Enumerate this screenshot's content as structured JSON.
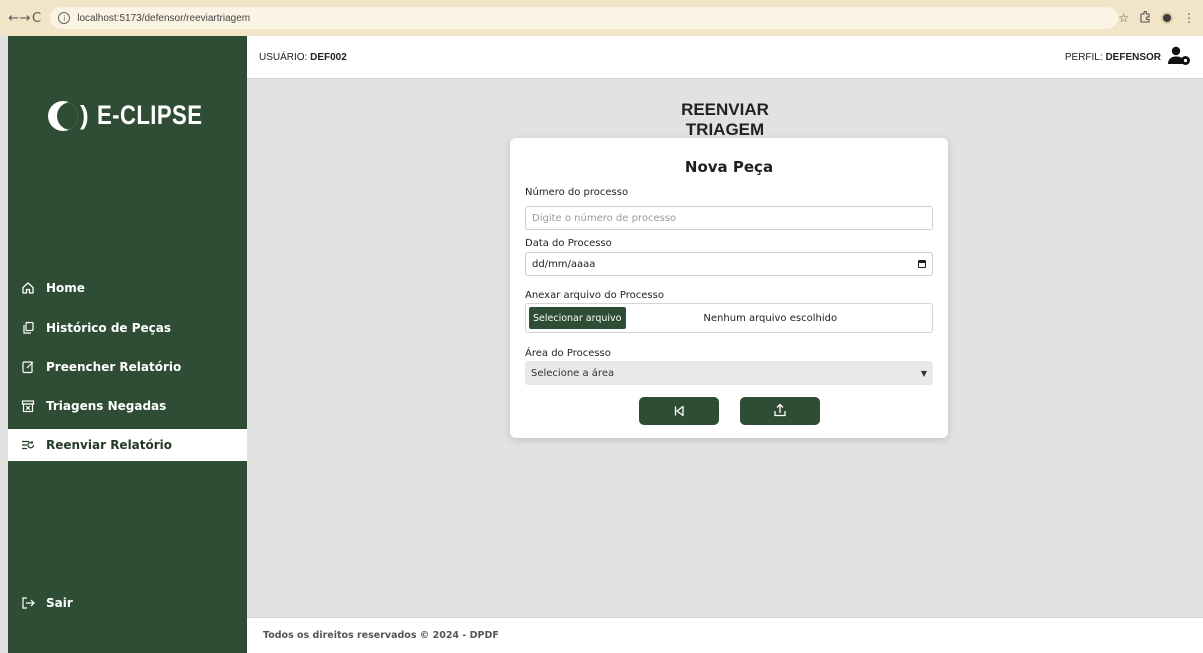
{
  "browser": {
    "url": "localhost:5173/defensor/reeviartriagem",
    "back_glyph": "←",
    "forward_glyph": "→",
    "reload_glyph": "C"
  },
  "sidebar": {
    "logo_text": "E-CLIPSE",
    "logo_paren": ")",
    "items": [
      {
        "label": "Home",
        "icon": "home-icon"
      },
      {
        "label": "Histórico de Peças",
        "icon": "history-icon"
      },
      {
        "label": "Preencher Relatório",
        "icon": "edit-report-icon"
      },
      {
        "label": "Triagens Negadas",
        "icon": "denied-box-icon"
      },
      {
        "label": "Reenviar Relatório",
        "icon": "resend-icon",
        "active": true
      }
    ],
    "logout_label": "Sair"
  },
  "header": {
    "user_prefix": "USUÁRIO:",
    "user_value": "DEF002",
    "profile_prefix": "PERFIL:",
    "profile_value": "DEFENSOR"
  },
  "page_title": "REENVIAR TRIAGEM",
  "form": {
    "title": "Nova Peça",
    "process_number_label": "Número do processo",
    "process_number_placeholder": "Digite o número de processo",
    "process_date_label": "Data do Processo",
    "process_date_value": "dd/mm/aaaa",
    "attach_label": "Anexar arquivo do Processo",
    "file_button_label": "Selecionar arquivo",
    "file_status": "Nenhum arquivo escolhido",
    "area_label": "Área do Processo",
    "area_selected": "Selecione a área"
  },
  "footer": {
    "text": "Todos os direitos reservados © 2024 - DPDF"
  },
  "colors": {
    "sidebar_bg": "#2f4d34",
    "page_bg": "#e2e2e2",
    "chrome_bg": "#f1e4c7"
  }
}
